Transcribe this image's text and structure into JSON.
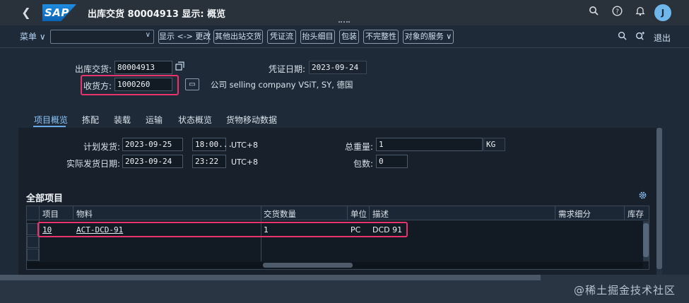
{
  "shell": {
    "logo": "SAP",
    "title": "出库交货 80004913 显示: 概览",
    "avatar": "J",
    "icons": [
      "search-icon",
      "help-icon",
      "bell-icon"
    ]
  },
  "toolbar": {
    "menu": "菜单",
    "combo_value": "",
    "buttons": [
      "显示 <-> 更改",
      "其他出站交货",
      "凭证流",
      "抬头细目",
      "包装",
      "不完整性",
      "对象的服务"
    ],
    "exit": "退出"
  },
  "header": {
    "delivery_label": "出库交货:",
    "delivery_value": "80004913",
    "doc_date_label": "凭证日期:",
    "doc_date_value": "2023-09-24",
    "shipto_label": "收货方:",
    "shipto_value": "1000260",
    "company_text": "公司 selling company VSiT, SY, 德国"
  },
  "tabs": [
    "项目概览",
    "拣配",
    "装载",
    "运输",
    "状态概览",
    "货物移动数据"
  ],
  "panel": {
    "plan_ship_label": "计划发货:",
    "plan_ship_date": "2023-09-25",
    "plan_ship_time": "18:00...",
    "plan_tz": "UTC+8",
    "actual_ship_label": "实际发货日期:",
    "actual_ship_date": "2023-09-24",
    "actual_ship_time": "23:22",
    "actual_tz": "UTC+8",
    "gross_weight_label": "总重量:",
    "gross_weight_value": "1",
    "weight_unit": "KG",
    "packages_label": "包数:",
    "packages_value": "0"
  },
  "items": {
    "section_title": "全部项目",
    "columns": [
      "项目",
      "物料",
      "交货数量",
      "单位",
      "描述",
      "需求细分",
      "库存"
    ],
    "rows": [
      {
        "item": "10",
        "material": "ACT-DCD-91",
        "qty": "1",
        "unit": "PC",
        "desc": "DCD 91"
      }
    ]
  },
  "watermark": "@稀土掘金技术社区"
}
